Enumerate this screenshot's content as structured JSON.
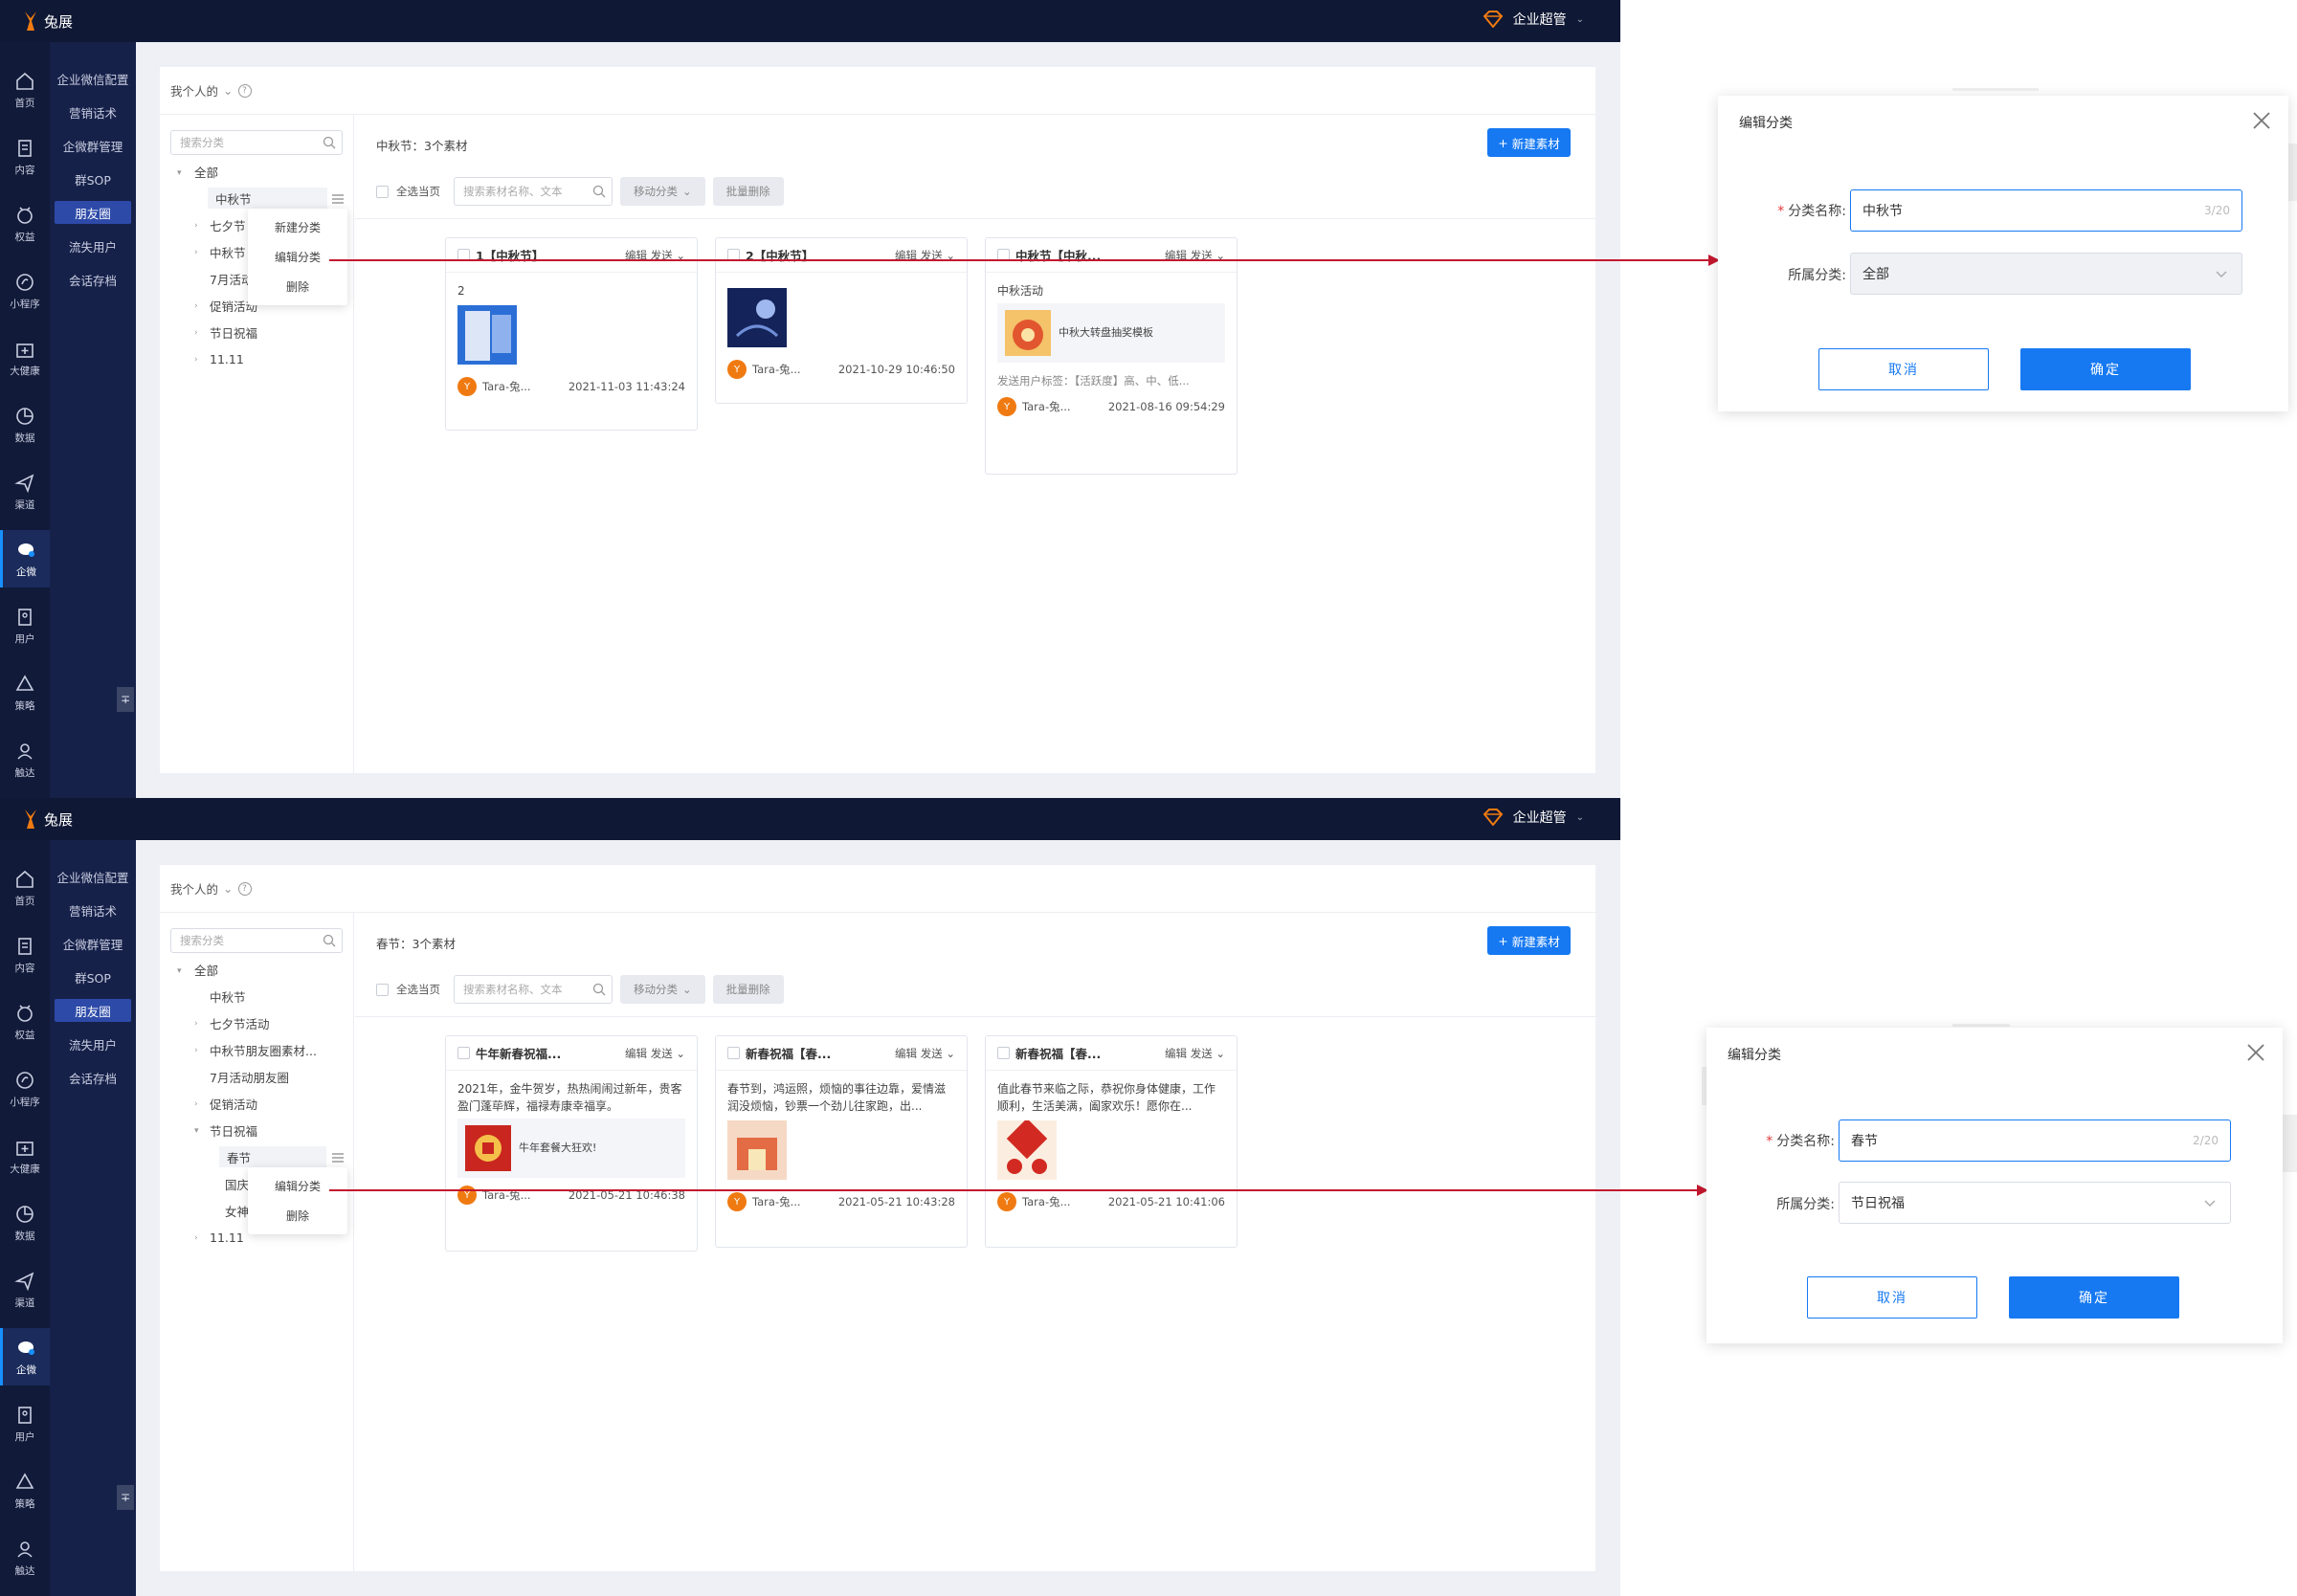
{
  "app": {
    "logo_text": "兔展",
    "user_name": "企业超管",
    "caret": "⌄"
  },
  "rail": {
    "items": [
      {
        "label": "首页",
        "icon": "home-icon"
      },
      {
        "label": "内容",
        "icon": "document-icon"
      },
      {
        "label": "权益",
        "icon": "gift-icon"
      },
      {
        "label": "小程序",
        "icon": "miniapp-icon"
      },
      {
        "label": "大健康",
        "icon": "health-icon"
      },
      {
        "label": "数据",
        "icon": "pie-chart-icon"
      },
      {
        "label": "渠道",
        "icon": "send-icon"
      },
      {
        "label": "企微",
        "icon": "wecom-icon"
      },
      {
        "label": "用户",
        "icon": "user-list-icon"
      },
      {
        "label": "策略",
        "icon": "strategy-icon"
      },
      {
        "label": "触达",
        "icon": "reach-icon"
      }
    ],
    "collapse_glyph": "∓"
  },
  "subnav": {
    "items": [
      "企业微信配置",
      "营销话术",
      "企微群管理",
      "群SOP",
      "朋友圈",
      "流失用户",
      "会话存档"
    ]
  },
  "page": {
    "scope": "我个人的",
    "scope_caret": "⌄",
    "help": "?",
    "tree_search_placeholder": "搜索分类",
    "search_placeholder": "搜索素材名称、文本",
    "select_all": "全选当页",
    "move_btn": "移动分类",
    "batch_delete": "批量删除",
    "new_btn": "新建素材",
    "new_btn_plus": "+"
  },
  "panel1": {
    "count": "中秋节：3个素材",
    "tree": {
      "all": "全部",
      "items": [
        "中秋节",
        "七夕节",
        "中秋节",
        "7月活动",
        "促销活动",
        "节日祝福",
        "11.11"
      ]
    },
    "context_menu": [
      "新建分类",
      "编辑分类",
      "删除"
    ],
    "cards": [
      {
        "title": "1【中秋节】",
        "text": "2",
        "author": "Tara-兔...",
        "date": "2021-11-03 11:43:24"
      },
      {
        "title": "2【中秋节】",
        "author": "Tara-兔...",
        "date": "2021-10-29 10:46:50"
      },
      {
        "title": "中秋节【中秋...",
        "text": "中秋活动",
        "link_title": "中秋大转盘抽奖模板",
        "tags": "发送用户标签：【活跃度】高、中、低...",
        "author": "Tara-兔...",
        "date": "2021-08-16 09:54:29"
      }
    ],
    "card_edit": "编辑",
    "card_send": "发送",
    "dialog": {
      "title": "编辑分类",
      "name_label": "分类名称:",
      "name_value": "中秋节",
      "name_count": "3/20",
      "parent_label": "所属分类:",
      "parent_value": "全部",
      "cancel": "取消",
      "ok": "确定"
    }
  },
  "panel2": {
    "count": "春节：3个素材",
    "tree": {
      "all": "全部",
      "items": [
        "中秋节",
        "七夕节活动",
        "中秋节朋友圈素材...",
        "7月活动朋友圈",
        "促销活动",
        "节日祝福",
        "春节",
        "国庆",
        "女神",
        "11.11"
      ]
    },
    "context_menu": [
      "编辑分类",
      "删除"
    ],
    "cards": [
      {
        "title": "牛年新春祝福...",
        "text": "2021年，金牛贺岁，热热闹闹过新年，贵客盈门蓬荜辉，福禄寿康幸福享。",
        "link_title": "牛年套餐大狂欢!",
        "author": "Tara-兔...",
        "date": "2021-05-21 10:46:38"
      },
      {
        "title": "新春祝福【春...",
        "text": "春节到，鸿运照，烦恼的事往边靠，爱情滋润没烦恼，钞票一个劲儿往家跑，出...",
        "author": "Tara-兔...",
        "date": "2021-05-21 10:43:28"
      },
      {
        "title": "新春祝福【春...",
        "text": "值此春节来临之际，恭祝你身体健康，工作顺利，生活美满，阖家欢乐！愿你在...",
        "author": "Tara-兔...",
        "date": "2021-05-21 10:41:06"
      }
    ],
    "card_edit": "编辑",
    "card_send": "发送",
    "dialog": {
      "title": "编辑分类",
      "name_label": "分类名称:",
      "name_value": "春节",
      "name_count": "2/20",
      "parent_label": "所属分类:",
      "parent_value": "节日祝福",
      "cancel": "取消",
      "ok": "确定"
    }
  },
  "colors": {
    "primary": "#1679f2",
    "topbar": "#0f1834",
    "sidebar": "#16214a",
    "arrow": "#c4182f",
    "required": "#e4393c"
  }
}
